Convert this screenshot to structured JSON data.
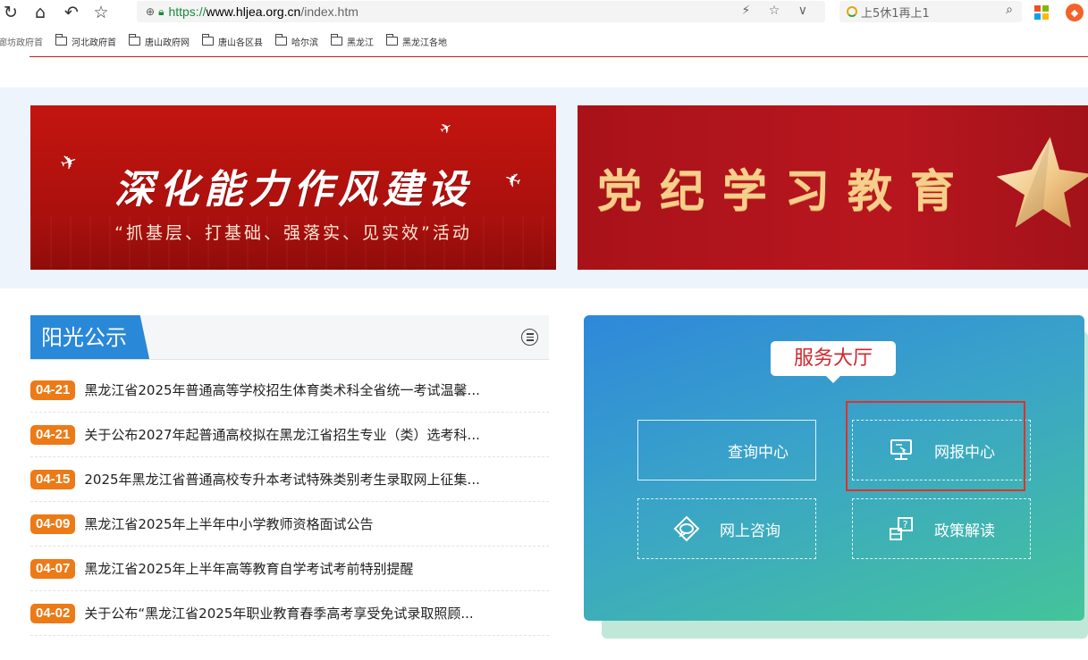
{
  "browser": {
    "url_scheme": "https://",
    "url_host": "www.hljea.org.cn",
    "url_path": "/index.htm",
    "search_text": "上5休1再上1",
    "right_icons": "⚡ ☆ ∨"
  },
  "bookmarks": [
    {
      "label": "廊坊政府首",
      "partial": true
    },
    {
      "label": "河北政府首"
    },
    {
      "label": "唐山政府网"
    },
    {
      "label": "唐山各区县"
    },
    {
      "label": "哈尔滨"
    },
    {
      "label": "黑龙江"
    },
    {
      "label": "黑龙江各地"
    }
  ],
  "banners": {
    "left_title": "深化能力作风建设",
    "left_subtitle": "“抓基层、打基础、强落实、见实效”活动",
    "right_title": "党纪学习教育"
  },
  "sunshine": {
    "title": "阳光公示",
    "items": [
      {
        "date": "04-21",
        "title": "黑龙江省2025年普通高等学校招生体育类术科全省统一考试温馨..."
      },
      {
        "date": "04-21",
        "title": "关于公布2027年起普通高校拟在黑龙江省招生专业（类）选考科..."
      },
      {
        "date": "04-15",
        "title": "2025年黑龙江省普通高校专升本考试特殊类别考生录取网上征集..."
      },
      {
        "date": "04-09",
        "title": "黑龙江省2025年上半年中小学教师资格面试公告"
      },
      {
        "date": "04-07",
        "title": "黑龙江省2025年上半年高等教育自学考试考前特别提醒"
      },
      {
        "date": "04-02",
        "title": "关于公布“黑龙江省2025年职业教育春季高考享受免试录取照顾..."
      }
    ]
  },
  "service_hall": {
    "title": "服务大厅",
    "query_center": "查询中心",
    "online_registration": "网报中心",
    "online_consult": "网上咨询",
    "policy_interpretation": "政策解读"
  },
  "colors": {
    "brand_blue": "#2a88d8",
    "date_orange": "#ec7a17",
    "highlight_red": "#e0312a"
  }
}
